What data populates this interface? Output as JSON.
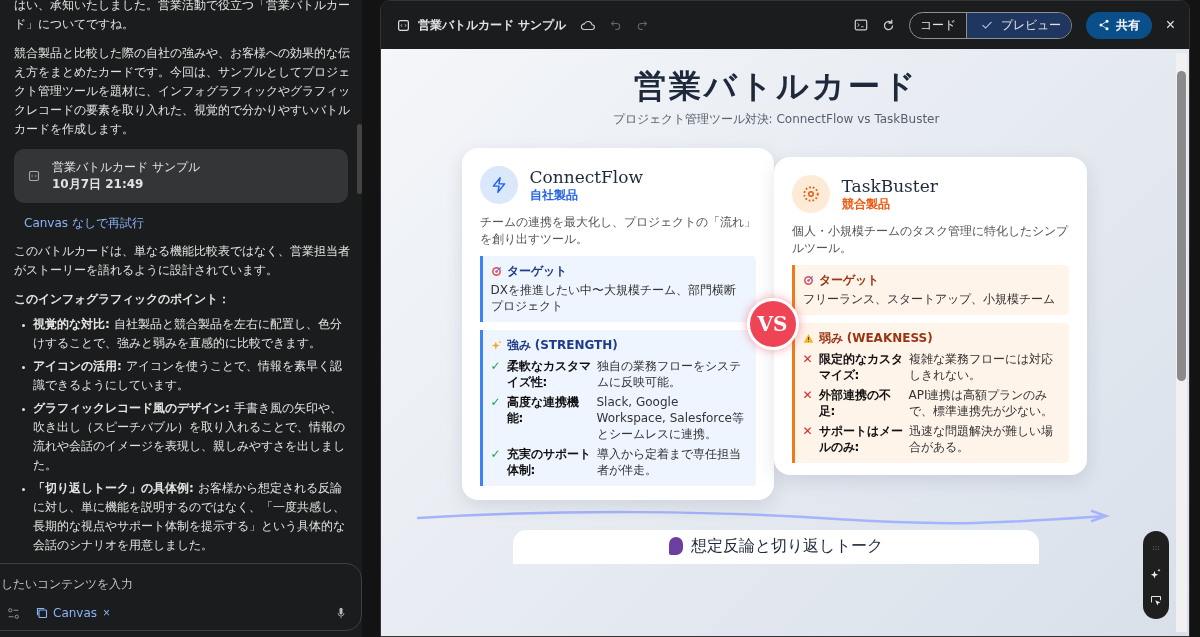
{
  "chat": {
    "paragraphs": [
      "はい、承知いたしました。営業活動で役立つ「営業バトルカード」についてですね。",
      "競合製品と比較した際の自社の強みや、お客様への効果的な伝え方をまとめたカードです。今回は、サンプルとしてプロジェクト管理ツールを題材に、インフォグラフィックやグラフィックレコードの要素を取り入れた、視覚的で分かりやすいバトルカードを作成します。"
    ],
    "artifact": {
      "title": "営業バトルカード サンプル",
      "time": "10月7日 21:49"
    },
    "retry_link": "Canvas なしで再試行",
    "intro": "このバトルカードは、単なる機能比較表ではなく、営業担当者がストーリーを語れるように設計されています。",
    "points_heading": "このインフォグラフィックのポイント：",
    "points": [
      "**視覚的な対比:** 自社製品と競合製品を左右に配置し、色分けすることで、強みと弱みを直感的に比較できます。",
      "**アイコンの活用:** アイコンを使うことで、情報を素早く認識できるようにしています。",
      "**グラフィックレコード風のデザイン:** 手書き風の矢印や、吹き出し（スピーチバブル）を取り入れることで、情報の流れや会話のイメージを表現し、親しみやすさを出しました。",
      "**「切り返しトーク」の具体例:** お客様から想定される反論に対し、単に機能を説明するのではなく、「一度共感し、長期的な視点やサポート体制を提示する」という具体的な会話のシナリオを用意しました。"
    ],
    "input": {
      "placeholder": "したいコンテンツを入力",
      "chip": "Canvas",
      "chip_close": "×"
    }
  },
  "canvas": {
    "title": "営業バトルカード サンプル",
    "view_toggle": [
      {
        "label": "コード",
        "selected": false
      },
      {
        "label": "プレビュー",
        "selected": true
      }
    ],
    "share": "共有",
    "close": "×"
  },
  "page": {
    "title": "営業バトルカード",
    "subtitle": "プロジェクト管理ツール対決: ConnectFlow vs TaskBuster",
    "cards": [
      {
        "kind": "own",
        "name": "ConnectFlow",
        "tag": "自社製品",
        "description": "チームの連携を最大化し、プロジェクトの「流れ」を創り出すツール。",
        "target": {
          "label": "ターゲット",
          "text": "DXを推進したい中〜大規模チーム、部門横断プロジェクト"
        },
        "section": {
          "label": "強み (STRENGTH)",
          "items": [
            {
              "mark": "✓",
              "term": "柔軟なカスタマイズ性:",
              "text": "独自の業務フローをシステムに反映可能。"
            },
            {
              "mark": "✓",
              "term": "高度な連携機能:",
              "text": "Slack, Google Workspace, Salesforce等とシームレスに連携。"
            },
            {
              "mark": "✓",
              "term": "充実のサポート体制:",
              "text": "導入から定着まで専任担当者が伴走。"
            }
          ]
        }
      },
      {
        "kind": "rival",
        "name": "TaskBuster",
        "tag": "競合製品",
        "description": "個人・小規模チームのタスク管理に特化したシンプルツール。",
        "target": {
          "label": "ターゲット",
          "text": "フリーランス、スタートアップ、小規模チーム"
        },
        "section": {
          "label": "弱み (WEAKNESS)",
          "items": [
            {
              "mark": "✕",
              "term": "限定的なカスタマイズ:",
              "text": "複雑な業務フローには対応しきれない。"
            },
            {
              "mark": "✕",
              "term": "外部連携の不足:",
              "text": "API連携は高額プランのみで、標準連携先が少ない。"
            },
            {
              "mark": "✕",
              "term": "サポートはメールのみ:",
              "text": "迅速な問題解決が難しい場合がある。"
            }
          ]
        }
      }
    ],
    "vs": "VS",
    "next_heading": "想定反論と切り返しトーク"
  }
}
